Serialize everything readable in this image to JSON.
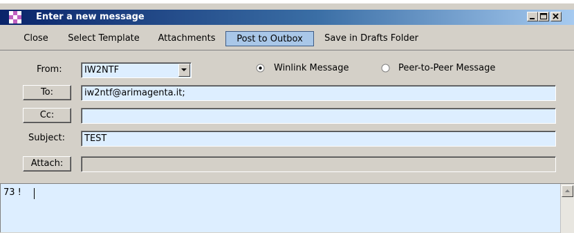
{
  "window": {
    "title": "Enter a new message",
    "controls": {
      "minimize": "_",
      "maximize": "□",
      "close": "×"
    }
  },
  "menubar": {
    "items": [
      {
        "label": "Close"
      },
      {
        "label": "Select Template"
      },
      {
        "label": "Attachments"
      },
      {
        "label": "Post to Outbox"
      },
      {
        "label": "Save in Drafts Folder"
      }
    ]
  },
  "form": {
    "from": {
      "label": "From:",
      "value": "IW2NTF"
    },
    "message_type": {
      "options": [
        {
          "label": "Winlink Message",
          "selected": true
        },
        {
          "label": "Peer-to-Peer Message",
          "selected": false
        }
      ]
    },
    "to": {
      "button": "To:",
      "value": "iw2ntf@arimagenta.it;"
    },
    "cc": {
      "button": "Cc:",
      "value": ""
    },
    "subject": {
      "label": "Subject:",
      "value": "TEST"
    },
    "attach": {
      "button": "Attach:",
      "value": ""
    }
  },
  "body": {
    "text": "73 !"
  },
  "colors": {
    "field_bg": "#ddeeff",
    "title_gradient_start": "#0a246a",
    "active_menu_bg": "#a9c7e8"
  }
}
